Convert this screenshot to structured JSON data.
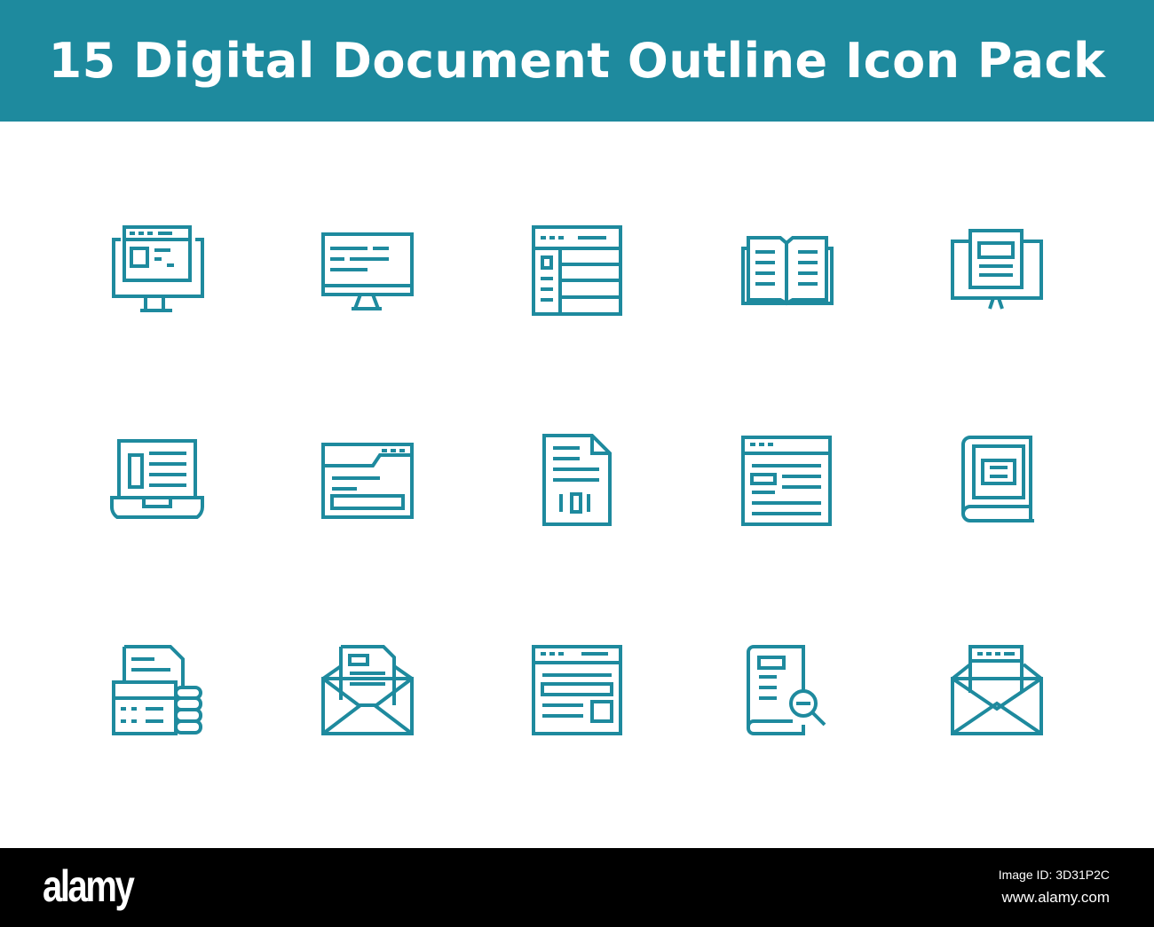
{
  "header": {
    "title": "15 Digital Document Outline Icon Pack",
    "color": "#1e8a9e"
  },
  "icons": [
    "monitor-web-page-icon",
    "monitor-document-icon",
    "browser-sidebar-layout-icon",
    "open-book-icon",
    "monitor-book-icon",
    "laptop-document-icon",
    "folder-window-icon",
    "binary-file-icon",
    "browser-article-icon",
    "ebook-icon",
    "document-stack-hand-icon",
    "envelope-document-icon",
    "browser-layout-icon",
    "book-search-icon",
    "open-envelope-letter-icon"
  ],
  "footer": {
    "logo": "alamy",
    "image_id": "Image ID: 3D31P2C",
    "site": "www.alamy.com"
  }
}
